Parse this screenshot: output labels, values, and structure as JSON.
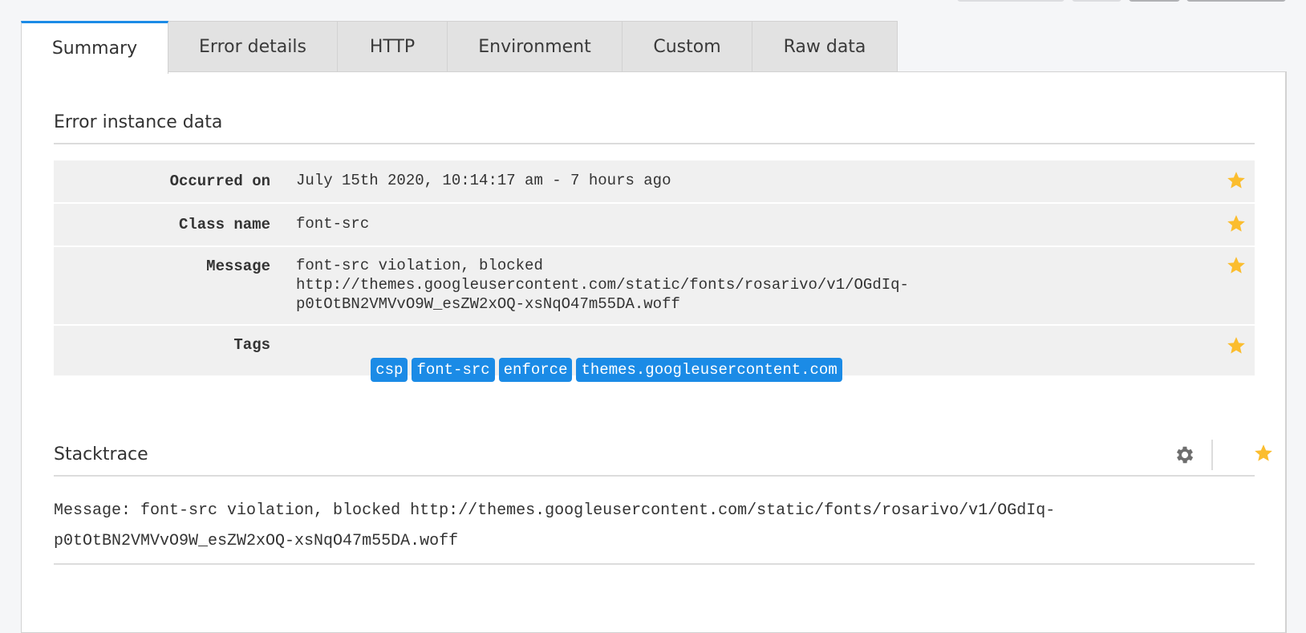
{
  "tabs": [
    {
      "label": "Summary",
      "active": true
    },
    {
      "label": "Error details",
      "active": false
    },
    {
      "label": "HTTP",
      "active": false
    },
    {
      "label": "Environment",
      "active": false
    },
    {
      "label": "Custom",
      "active": false
    },
    {
      "label": "Raw data",
      "active": false
    }
  ],
  "error_instance": {
    "title": "Error instance data",
    "rows": [
      {
        "label": "Occurred on",
        "value": "July 15th 2020, 10:14:17 am - 7 hours ago"
      },
      {
        "label": "Class name",
        "value": "font-src"
      },
      {
        "label": "Message",
        "value": "font-src violation, blocked\nhttp://themes.googleusercontent.com/static/fonts/rosarivo/v1/OGdIq-\np0tOtBN2VMVvO9W_esZW2xOQ-xsNqO47m55DA.woff"
      },
      {
        "label": "Tags",
        "tags": [
          "csp",
          "font-src",
          "enforce",
          "themes.googleusercontent.com"
        ]
      }
    ]
  },
  "stacktrace": {
    "title": "Stacktrace",
    "text": "Message: font-src violation, blocked http://themes.googleusercontent.com/static/fonts/rosarivo/v1/OGdIq-\np0tOtBN2VMVvO9W_esZW2xOQ-xsNqO47m55DA.woff"
  },
  "icons": {
    "favorite": "star-icon",
    "settings": "gear-icon"
  },
  "colors": {
    "accent": "#1b8be6",
    "star": "#fbbd2e",
    "gear": "#6e6e6e",
    "row_bg": "#f0f0f0"
  }
}
